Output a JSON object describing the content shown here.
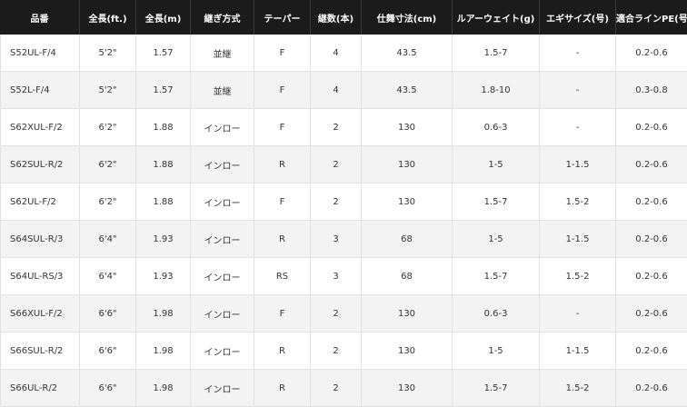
{
  "table": {
    "headers": [
      "品番",
      "全長(ft.)",
      "全長(m)",
      "継ぎ方式",
      "テーパー",
      "継数(本)",
      "仕舞寸法(cm)",
      "ルアーウェイト(g)",
      "エギサイズ(号)",
      "適合ラインPE(号)"
    ],
    "rows": [
      [
        "S52UL-F/4",
        "5'2\"",
        "1.57",
        "並継",
        "F",
        "4",
        "43.5",
        "1.5-7",
        "-",
        "0.2-0.6"
      ],
      [
        "S52L-F/4",
        "5'2\"",
        "1.57",
        "並継",
        "F",
        "4",
        "43.5",
        "1.8-10",
        "-",
        "0.3-0.8"
      ],
      [
        "S62XUL-F/2",
        "6'2\"",
        "1.88",
        "インロー",
        "F",
        "2",
        "130",
        "0.6-3",
        "-",
        "0.2-0.6"
      ],
      [
        "S62SUL-R/2",
        "6'2\"",
        "1.88",
        "インロー",
        "R",
        "2",
        "130",
        "1-5",
        "1-1.5",
        "0.2-0.6"
      ],
      [
        "S62UL-F/2",
        "6'2\"",
        "1.88",
        "インロー",
        "F",
        "2",
        "130",
        "1.5-7",
        "1.5-2",
        "0.2-0.6"
      ],
      [
        "S64SUL-R/3",
        "6'4\"",
        "1.93",
        "インロー",
        "R",
        "3",
        "68",
        "1-5",
        "1-1.5",
        "0.2-0.6"
      ],
      [
        "S64UL-RS/3",
        "6'4\"",
        "1.93",
        "インロー",
        "RS",
        "3",
        "68",
        "1.5-7",
        "1.5-2",
        "0.2-0.6"
      ],
      [
        "S66XUL-F/2",
        "6'6\"",
        "1.98",
        "インロー",
        "F",
        "2",
        "130",
        "0.6-3",
        "-",
        "0.2-0.6"
      ],
      [
        "S66SUL-R/2",
        "6'6\"",
        "1.98",
        "インロー",
        "R",
        "2",
        "130",
        "1-5",
        "1-1.5",
        "0.2-0.6"
      ],
      [
        "S66UL-R/2",
        "6'6\"",
        "1.98",
        "インロー",
        "R",
        "2",
        "130",
        "1.5-7",
        "1.5-2",
        "0.2-0.6"
      ]
    ]
  }
}
